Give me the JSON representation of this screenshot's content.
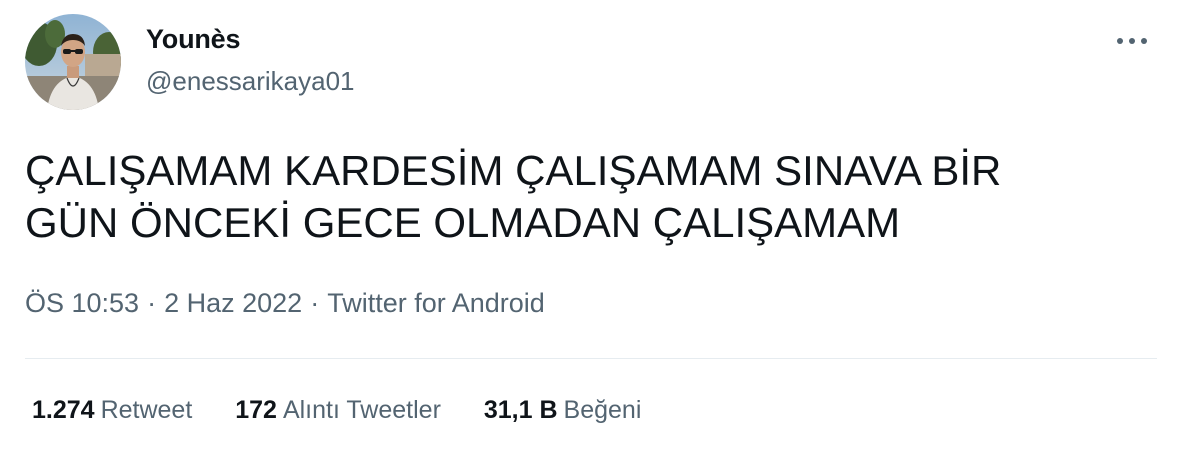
{
  "author": {
    "display_name": "Younès",
    "handle": "@enessarikaya01"
  },
  "tweet": {
    "text": "ÇALIŞAMAM KARDESİM ÇALIŞAMAM SINAVA BİR\nGÜN ÖNCEKİ GECE OLMADAN ÇALIŞAMAM"
  },
  "meta": {
    "time": "ÖS 10:53",
    "separator": "·",
    "date": "2 Haz 2022",
    "source": "Twitter for Android"
  },
  "stats": {
    "retweets": {
      "count": "1.274",
      "label": "Retweet"
    },
    "quotes": {
      "count": "172",
      "label": "Alıntı Tweetler"
    },
    "likes": {
      "count": "31,1 B",
      "label": "Beğeni"
    }
  },
  "icons": {
    "more": "more-horizontal-icon",
    "avatar": "profile-photo"
  },
  "colors": {
    "text_primary": "#0f1419",
    "text_secondary": "#536471",
    "divider": "#e6ecf0"
  }
}
